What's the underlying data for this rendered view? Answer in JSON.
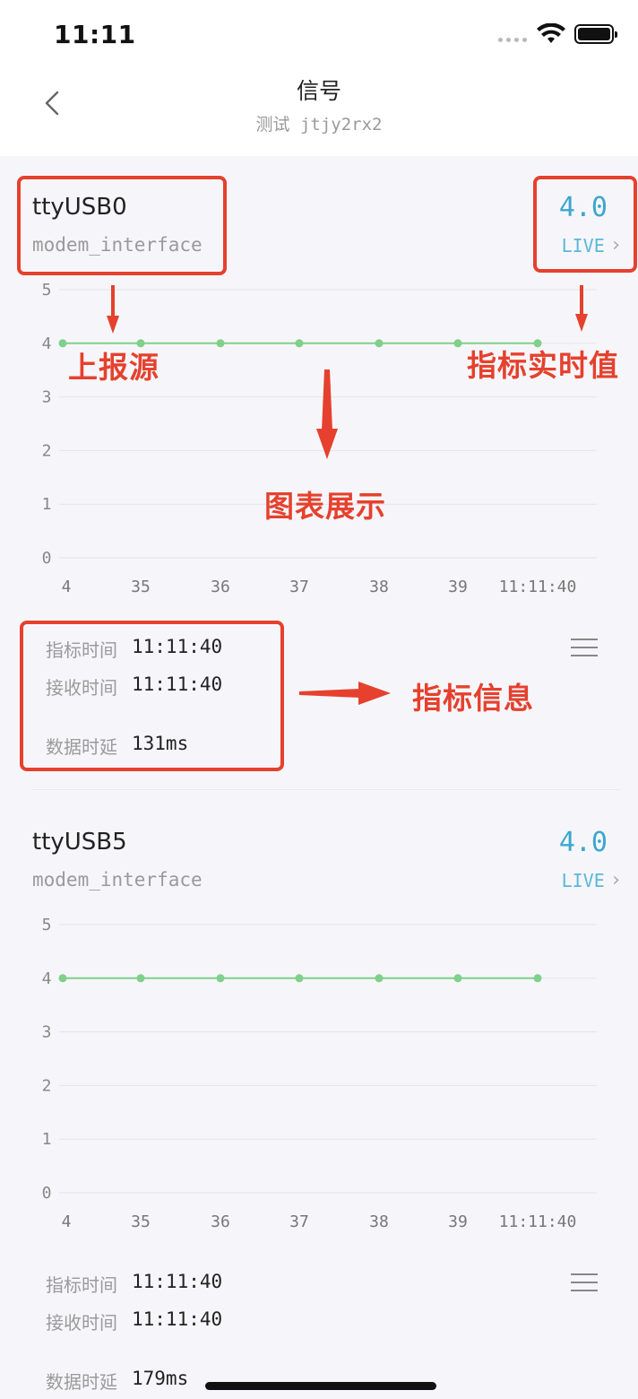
{
  "status_bar": {
    "time": "11:11"
  },
  "nav": {
    "title": "信号",
    "subtitle": "测试 jtjy2rx2"
  },
  "cards": [
    {
      "source_name": "ttyUSB0",
      "source_type": "modem_interface",
      "live_value": "4.0",
      "live_label": "LIVE",
      "chart_data": {
        "type": "line",
        "x": [
          "4",
          "35",
          "36",
          "37",
          "38",
          "39",
          "11:11:40"
        ],
        "series": [
          {
            "values": [
              4,
              4,
              4,
              4,
              4,
              4,
              4
            ]
          }
        ],
        "yticks": [
          "0",
          "1",
          "2",
          "3",
          "4",
          "5"
        ],
        "ylim": [
          0,
          5
        ],
        "grid": true,
        "color": "#7fd08a"
      },
      "info": {
        "metric_time_label": "指标时间",
        "metric_time": "11:11:40",
        "receive_time_label": "接收时间",
        "receive_time": "11:11:40",
        "delay_label": "数据时延",
        "delay": "131ms"
      }
    },
    {
      "source_name": "ttyUSB5",
      "source_type": "modem_interface",
      "live_value": "4.0",
      "live_label": "LIVE",
      "chart_data": {
        "type": "line",
        "x": [
          "4",
          "35",
          "36",
          "37",
          "38",
          "39",
          "11:11:40"
        ],
        "series": [
          {
            "values": [
              4,
              4,
              4,
              4,
              4,
              4,
              4
            ]
          }
        ],
        "yticks": [
          "0",
          "1",
          "2",
          "3",
          "4",
          "5"
        ],
        "ylim": [
          0,
          5
        ],
        "grid": true,
        "color": "#7fd08a"
      },
      "info": {
        "metric_time_label": "指标时间",
        "metric_time": "11:11:40",
        "receive_time_label": "接收时间",
        "receive_time": "11:11:40",
        "delay_label": "数据时延",
        "delay": "179ms"
      }
    }
  ],
  "annotations": {
    "source": "上报源",
    "live_value": "指标实时值",
    "chart": "图表展示",
    "info": "指标信息",
    "color": "#e5412e"
  }
}
